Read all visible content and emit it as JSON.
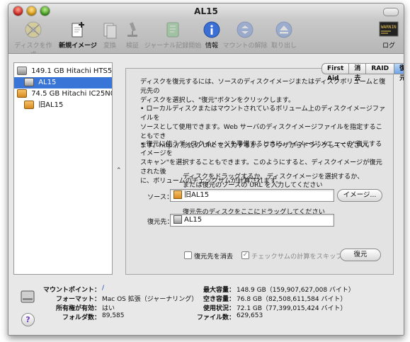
{
  "window": {
    "title": "AL15"
  },
  "toolbar": {
    "items": [
      {
        "label": "ディスクを作成",
        "icon": "burn-disc-icon",
        "enabled": false
      },
      {
        "label": "新規イメージ",
        "icon": "new-image-icon",
        "enabled": true
      },
      {
        "label": "変換",
        "icon": "convert-icon",
        "enabled": false
      },
      {
        "label": "検証",
        "icon": "verify-microscope-icon",
        "enabled": false
      },
      {
        "label": "ジャーナル記録開始",
        "icon": "journal-icon",
        "enabled": false
      },
      {
        "label": "情報",
        "icon": "info-icon",
        "enabled": true
      },
      {
        "label": "マウントの解除",
        "icon": "unmount-icon",
        "enabled": false
      },
      {
        "label": "取り出し",
        "icon": "eject-icon",
        "enabled": false
      }
    ],
    "log": {
      "label": "ログ",
      "icon": "log-console-icon",
      "badge": "WARNIN"
    }
  },
  "sidebar": {
    "items": [
      {
        "label": "149.1 GB Hitachi HTS54...",
        "level": 0,
        "selected": false
      },
      {
        "label": "AL15",
        "level": 1,
        "selected": true
      },
      {
        "label": "74.5 GB Hitachi IC25N0...",
        "level": 0,
        "selected": false
      },
      {
        "label": "旧AL15",
        "level": 1,
        "selected": false
      }
    ]
  },
  "tabs": [
    {
      "label": "First Aid",
      "active": false
    },
    {
      "label": "消去",
      "active": false
    },
    {
      "label": "RAID",
      "active": false
    },
    {
      "label": "復元",
      "active": true
    }
  ],
  "restore": {
    "intro": [
      "ディスクを復元するには、ソースのディスクイメージまたはディスクボリュームと復元先の",
      "ディスクを選択し、\"復元\"ボタンをクリックします。"
    ],
    "para2": [
      "• ローカルディスクまたはマウントされているボリューム上のディスクイメージファイルを",
      "ソースとして使用できます。Web サーバのディスクイメージファイルを指定することもでき",
      "ます。http:// 形式の URL を入力するか、ブラウザからドラッグしてください。"
    ],
    "para3": [
      "• 復元に使うディスクイメージを準備するときに、\"イメージ\"メニューの\"復元するイメージを",
      "スキャン\"を選択することもできます。このようにすると、ディスクイメージが復元された後",
      "に、ボリュームのチェックサムが計算されます。"
    ],
    "source_hint": [
      "ディスクをドラッグするか、ディスクイメージを選択するか、",
      "または復元のソースの URL を入力してください"
    ],
    "source_label": "ソース：",
    "source_value": "旧AL15",
    "image_button": "イメージ...",
    "dest_hint": "復元先のディスクをここにドラッグしてください",
    "dest_label": "復元先：",
    "dest_value": "AL15",
    "erase_dest_label": "復元先を消去",
    "erase_dest_checked": false,
    "skip_checksum_label": "チェックサムの計算をスキップ",
    "skip_checksum_checked": true,
    "restore_button": "復元"
  },
  "info": {
    "mount_point_label": "マウントポイント：",
    "mount_point_value": "/",
    "format_label": "フォーマット：",
    "format_value": "Mac OS 拡張（ジャーナリング）",
    "owners_label": "所有権が有効：",
    "owners_value": "はい",
    "folders_label": "フォルダ数：",
    "folders_value": "89,585",
    "capacity_label": "最大容量：",
    "capacity_value": "148.9 GB（159,907,627,008 バイト）",
    "available_label": "空き容量：",
    "available_value": "76.8 GB（82,508,611,584 バイト）",
    "used_label": "使用状況：",
    "used_value": "72.1 GB（77,399,015,424 バイト）",
    "files_label": "ファイル数：",
    "files_value": "629,653"
  },
  "help_label": "?",
  "splitter_label": "⌃"
}
